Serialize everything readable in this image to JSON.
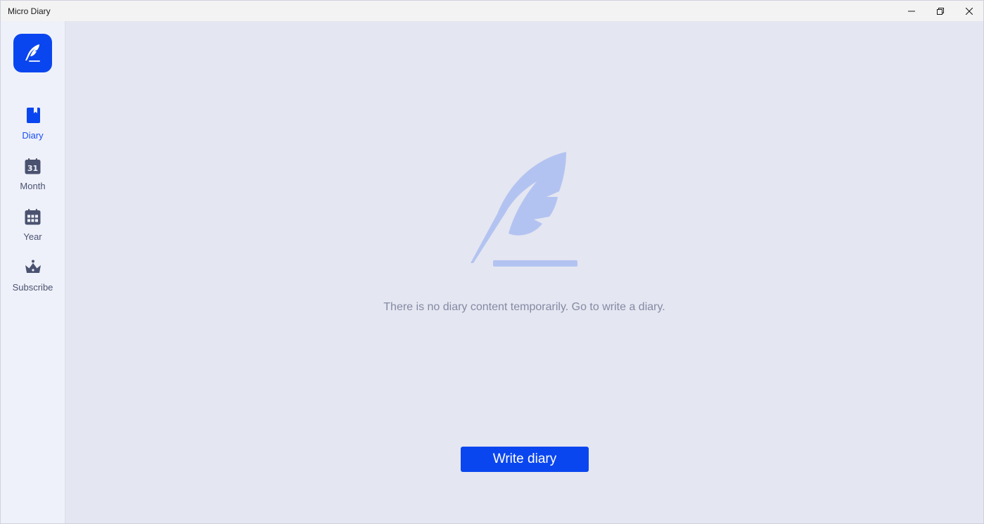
{
  "window": {
    "title": "Micro Diary",
    "controls": {
      "minimize_icon": "minimize-icon",
      "restore_icon": "restore-icon",
      "close_icon": "close-icon"
    }
  },
  "sidebar": {
    "logo_icon": "feather-icon",
    "items": [
      {
        "label": "Diary",
        "icon": "bookmark-book-icon",
        "active": true
      },
      {
        "label": "Month",
        "icon": "calendar-31-icon",
        "active": false
      },
      {
        "label": "Year",
        "icon": "calendar-grid-icon",
        "active": false
      },
      {
        "label": "Subscribe",
        "icon": "crown-icon",
        "active": false
      }
    ],
    "calendar_day_number": "31"
  },
  "main": {
    "empty_state": {
      "illustration_icon": "feather-pen-icon",
      "message": "There is no diary content temporarily. Go to write a diary."
    },
    "write_button_label": "Write diary"
  },
  "colors": {
    "accent": "#0a46ef",
    "main_background": "#e4e6f1",
    "sidebar_background": "#eff1fa",
    "illustration": "#b3c3f1",
    "nav_icon": "#4a5270",
    "message_text": "#858aa3"
  }
}
